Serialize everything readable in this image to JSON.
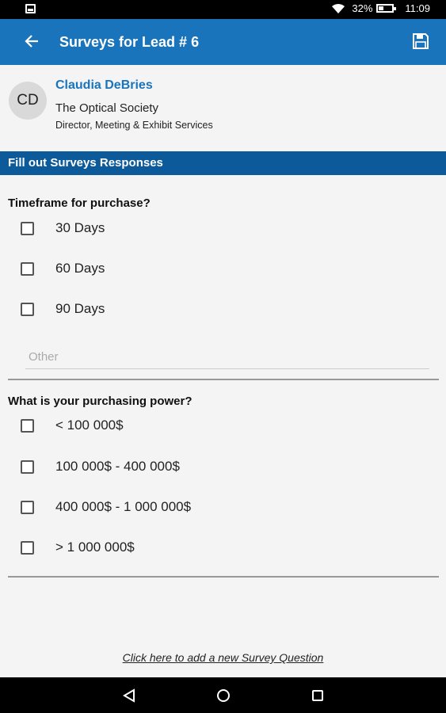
{
  "status_bar": {
    "battery_percent": "32%",
    "time": "11:09"
  },
  "app_bar": {
    "title": "Surveys for Lead # 6",
    "back_icon": "arrow-left-icon",
    "save_icon": "floppy-disk-icon"
  },
  "contact": {
    "initials": "CD",
    "name": "Claudia DeBries",
    "company": "The Optical Society",
    "title": "Director, Meeting & Exhibit Services"
  },
  "section_header": "Fill out Surveys Responses",
  "questions": [
    {
      "text": "Timeframe for purchase?",
      "options": [
        {
          "label": "30 Days",
          "checked": false
        },
        {
          "label": "60 Days",
          "checked": false
        },
        {
          "label": "90 Days",
          "checked": false
        }
      ],
      "other_placeholder": "Other",
      "other_value": ""
    },
    {
      "text": "What is your purchasing power?",
      "options": [
        {
          "label": "< 100 000$",
          "checked": false
        },
        {
          "label": "100 000$ - 400 000$",
          "checked": false
        },
        {
          "label": "400 000$ - 1 000 000$",
          "checked": false
        },
        {
          "label": "> 1 000 000$",
          "checked": false
        }
      ]
    }
  ],
  "add_question_link": "Click here to add a new Survey Question",
  "nav_bar": {
    "back_icon": "triangle-back-icon",
    "home_icon": "circle-home-icon",
    "recents_icon": "square-recents-icon"
  },
  "colors": {
    "app_bar": "#1a74bb",
    "section_header": "#0c5a99",
    "contact_name": "#1a74bb"
  }
}
